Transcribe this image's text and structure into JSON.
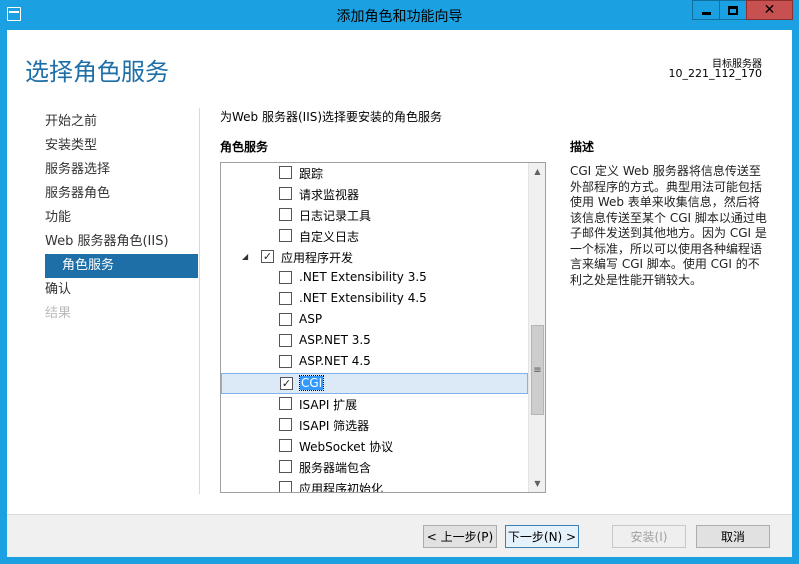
{
  "window": {
    "title": "添加角色和功能向导",
    "close_glyph": "✕"
  },
  "header": {
    "page_title": "选择角色服务",
    "target_label": "目标服务器",
    "target_name": "10_221_112_170"
  },
  "nav": {
    "items": [
      {
        "label": "开始之前",
        "state": "normal"
      },
      {
        "label": "安装类型",
        "state": "normal"
      },
      {
        "label": "服务器选择",
        "state": "normal"
      },
      {
        "label": "服务器角色",
        "state": "normal"
      },
      {
        "label": "功能",
        "state": "normal"
      },
      {
        "label": "Web 服务器角色(IIS)",
        "state": "normal"
      },
      {
        "label": "角色服务",
        "state": "selected"
      },
      {
        "label": "确认",
        "state": "normal"
      },
      {
        "label": "结果",
        "state": "disabled"
      }
    ]
  },
  "main": {
    "instruction": "为Web 服务器(IIS)选择要安装的角色服务",
    "column_header": "角色服务",
    "tree": [
      {
        "label": "跟踪",
        "checked": false
      },
      {
        "label": "请求监视器",
        "checked": false
      },
      {
        "label": "日志记录工具",
        "checked": false
      },
      {
        "label": "自定义日志",
        "checked": false
      },
      {
        "label": "应用程序开发",
        "checked": true,
        "expanded": true
      },
      {
        "label": ".NET Extensibility 3.5",
        "checked": false
      },
      {
        "label": ".NET Extensibility 4.5",
        "checked": false
      },
      {
        "label": "ASP",
        "checked": false
      },
      {
        "label": "ASP.NET 3.5",
        "checked": false
      },
      {
        "label": "ASP.NET 4.5",
        "checked": false
      },
      {
        "label": "CGI",
        "checked": true,
        "selected": true
      },
      {
        "label": "ISAPI 扩展",
        "checked": false
      },
      {
        "label": "ISAPI 筛选器",
        "checked": false
      },
      {
        "label": "WebSocket 协议",
        "checked": false
      },
      {
        "label": "服务器端包含",
        "checked": false
      },
      {
        "label": "应用程序初始化",
        "checked": false
      }
    ],
    "check_glyph": "✓",
    "expanded_arrow": "◢",
    "scrollbar": {
      "up": "▲",
      "down": "▼",
      "grip": "≡"
    }
  },
  "description": {
    "title": "描述",
    "text": "CGI 定义 Web 服务器将信息传送至外部程序的方式。典型用法可能包括使用 Web 表单来收集信息，然后将该信息传送至某个 CGI 脚本以通过电子邮件发送到其他地方。因为 CGI 是一个标准，所以可以使用各种编程语言来编写 CGI 脚本。使用 CGI 的不利之处是性能开销较大。"
  },
  "footer": {
    "prev": "< 上一步(P)",
    "next": "下一步(N) >",
    "install": "安装(I)",
    "cancel": "取消"
  }
}
